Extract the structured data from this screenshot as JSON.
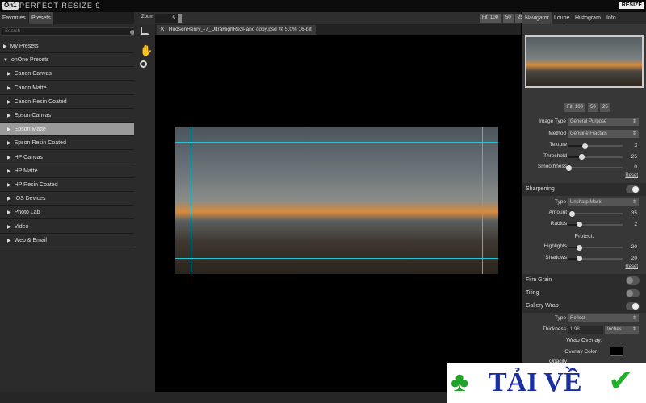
{
  "app": {
    "logo": "On1",
    "title": "PERFECT RESIZE 9",
    "resize_button": "RESIZE"
  },
  "left": {
    "tabs": [
      "Favorites",
      "Presets"
    ],
    "search_placeholder": "Search",
    "items": [
      {
        "label": "My Presets",
        "level": 0
      },
      {
        "label": "onOne Presets",
        "level": 0,
        "expanded": true
      },
      {
        "label": "Canon Canvas",
        "level": 1
      },
      {
        "label": "Canon Matte",
        "level": 1
      },
      {
        "label": "Canon Resin Coated",
        "level": 1
      },
      {
        "label": "Epson Canvas",
        "level": 1
      },
      {
        "label": "Epson Matte",
        "level": 1,
        "selected": true
      },
      {
        "label": "Epson Resin Coated",
        "level": 1
      },
      {
        "label": "HP Canvas",
        "level": 1
      },
      {
        "label": "HP Matte",
        "level": 1
      },
      {
        "label": "HP Resin Coated",
        "level": 1
      },
      {
        "label": "IOS Devices",
        "level": 1
      },
      {
        "label": "Photo Lab",
        "level": 1
      },
      {
        "label": "Video",
        "level": 1
      },
      {
        "label": "Web & Email",
        "level": 1
      }
    ]
  },
  "toolbar": {
    "zoom_label": "Zoom",
    "zoom_value": "5",
    "view_buttons": [
      "Fit",
      "100",
      "50",
      "25"
    ],
    "file_tab": "HudsonHenry_-7_UltraHighRezPano copy.psd @ 5.0% 16-bit",
    "file_close": "X"
  },
  "right": {
    "tabs": [
      "Navigator",
      "Loupe",
      "Histogram",
      "Info"
    ],
    "nav_buttons": [
      "Fit",
      "100",
      "50",
      "25"
    ],
    "image_type": {
      "label": "Image Type",
      "value": "General Purpose"
    },
    "method": {
      "label": "Method",
      "value": "Genuine Fractals"
    },
    "resize_sliders": [
      {
        "label": "Texture",
        "value": 3,
        "max": 10
      },
      {
        "label": "Threshold",
        "value": 25,
        "max": 100
      },
      {
        "label": "Smoothness",
        "value": 0,
        "max": 100
      }
    ],
    "reset": "Reset",
    "sharpening": {
      "title": "Sharpening",
      "on": true,
      "type_label": "Type",
      "type": "Unsharp Mask",
      "sliders": [
        {
          "label": "Amount",
          "value": 35,
          "max": 500
        },
        {
          "label": "Radius",
          "value": 2,
          "max": 10
        }
      ],
      "protect_title": "Protect:",
      "protect": [
        {
          "label": "Highlights",
          "value": 20,
          "max": 100
        },
        {
          "label": "Shadows",
          "value": 20,
          "max": 100
        }
      ]
    },
    "film_grain": {
      "title": "Film Grain",
      "on": false
    },
    "tiling": {
      "title": "Tiling",
      "on": false
    },
    "gallery_wrap": {
      "title": "Gallery Wrap",
      "on": true,
      "type_label": "Type",
      "type": "Reflect",
      "thickness_label": "Thickness",
      "thickness": "1.98",
      "unit": "Inches",
      "overlay_title": "Wrap Overlay:",
      "overlay_color_label": "Overlay Color",
      "overlay_color": "#000000",
      "opacity_label": "Opacity"
    }
  },
  "watermark": {
    "text": "TẢI VỀ"
  }
}
